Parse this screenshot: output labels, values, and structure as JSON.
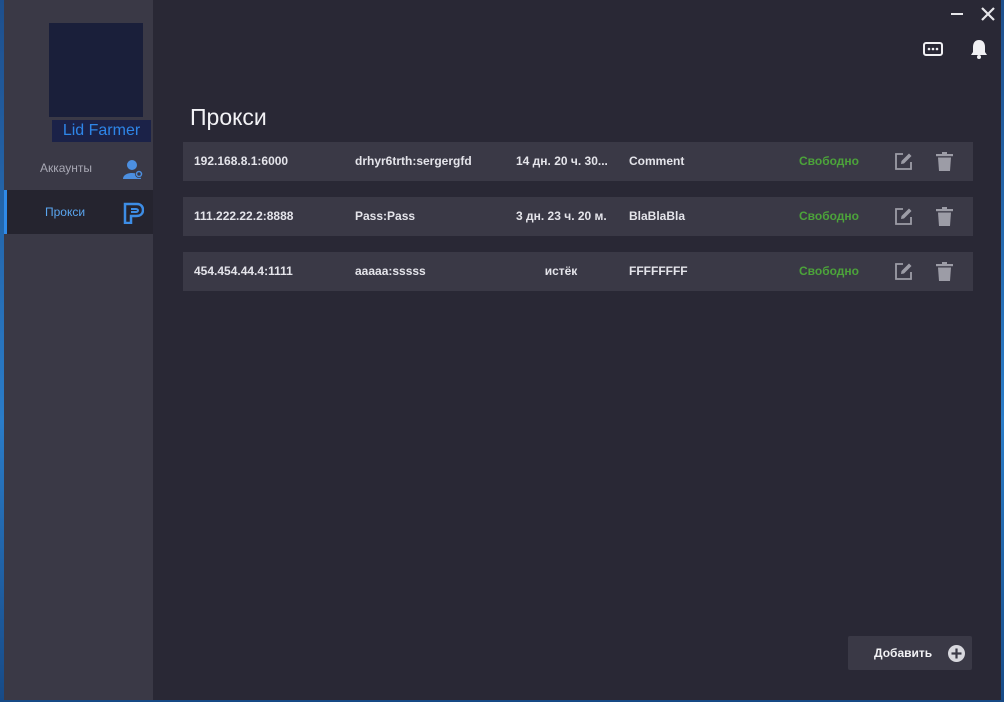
{
  "app": {
    "logo_label": "Lid Farmer",
    "page_title": "Прокси"
  },
  "sidebar": {
    "items": [
      {
        "label": "Аккаунты",
        "icon": "user-icon",
        "active": false
      },
      {
        "label": "Прокси",
        "icon": "proxy-logo-icon",
        "active": true
      }
    ]
  },
  "window_controls": [
    "minimize-icon",
    "close-icon"
  ],
  "header_icons": [
    "chat-icon",
    "bell-icon"
  ],
  "proxies": {
    "rows": [
      {
        "address": "192.168.8.1:6000",
        "auth": "drhyr6trth:sergergfd",
        "time_left": "14 дн. 20 ч. 30...",
        "comment": "Comment",
        "status": "Свободно"
      },
      {
        "address": "111.222.22.2:8888",
        "auth": "Pass:Pass",
        "time_left": "3 дн. 23 ч. 20 м.",
        "comment": "BlaBlaBla",
        "status": "Свободно"
      },
      {
        "address": "454.454.44.4:1111",
        "auth": "aaaaa:sssss",
        "time_left": "истёк",
        "comment": "FFFFFFFF",
        "status": "Свободно"
      }
    ]
  },
  "actions": {
    "add_label": "Добавить"
  },
  "colors": {
    "accent": "#2f8ae8",
    "status_free": "#4ca33a",
    "background": "#292835",
    "sidebar": "#3a3946"
  }
}
